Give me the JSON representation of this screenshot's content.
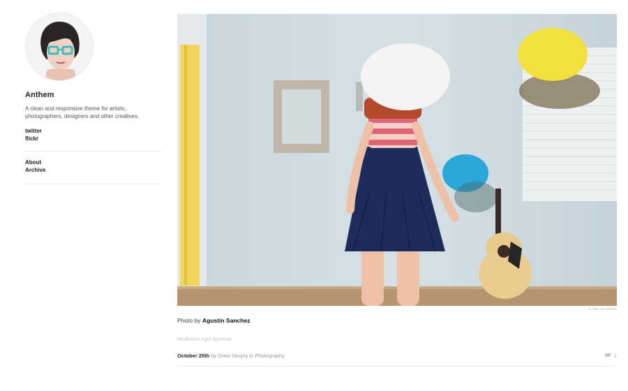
{
  "site": {
    "title": "Anthem",
    "description": "A clean and responsive theme for artists, photographers, designers and other creatives.",
    "social_links": [
      "twitter",
      "flickr"
    ],
    "nav_links": [
      "About",
      "Archive"
    ]
  },
  "post": {
    "photo_credit_small": "© high res version",
    "caption_prefix": "Photo by",
    "caption_author": "Agustin Sanchez",
    "tags": [
      "#balloons",
      "#girl",
      "#portrait"
    ],
    "date": "October 25th",
    "byline_by": "by",
    "author": "Drew Strojny",
    "byline_in": "in",
    "category": "Photography",
    "comment_count": "1"
  },
  "colors": {
    "wall": "#cfdbe0",
    "floor": "#b79470",
    "curtain": "#f0d55a",
    "balloon_white": "#f6f4f2",
    "balloon_yellow": "#f2e03c",
    "balloon_blue": "#2aa7d6",
    "dress": "#1f2b5a"
  }
}
